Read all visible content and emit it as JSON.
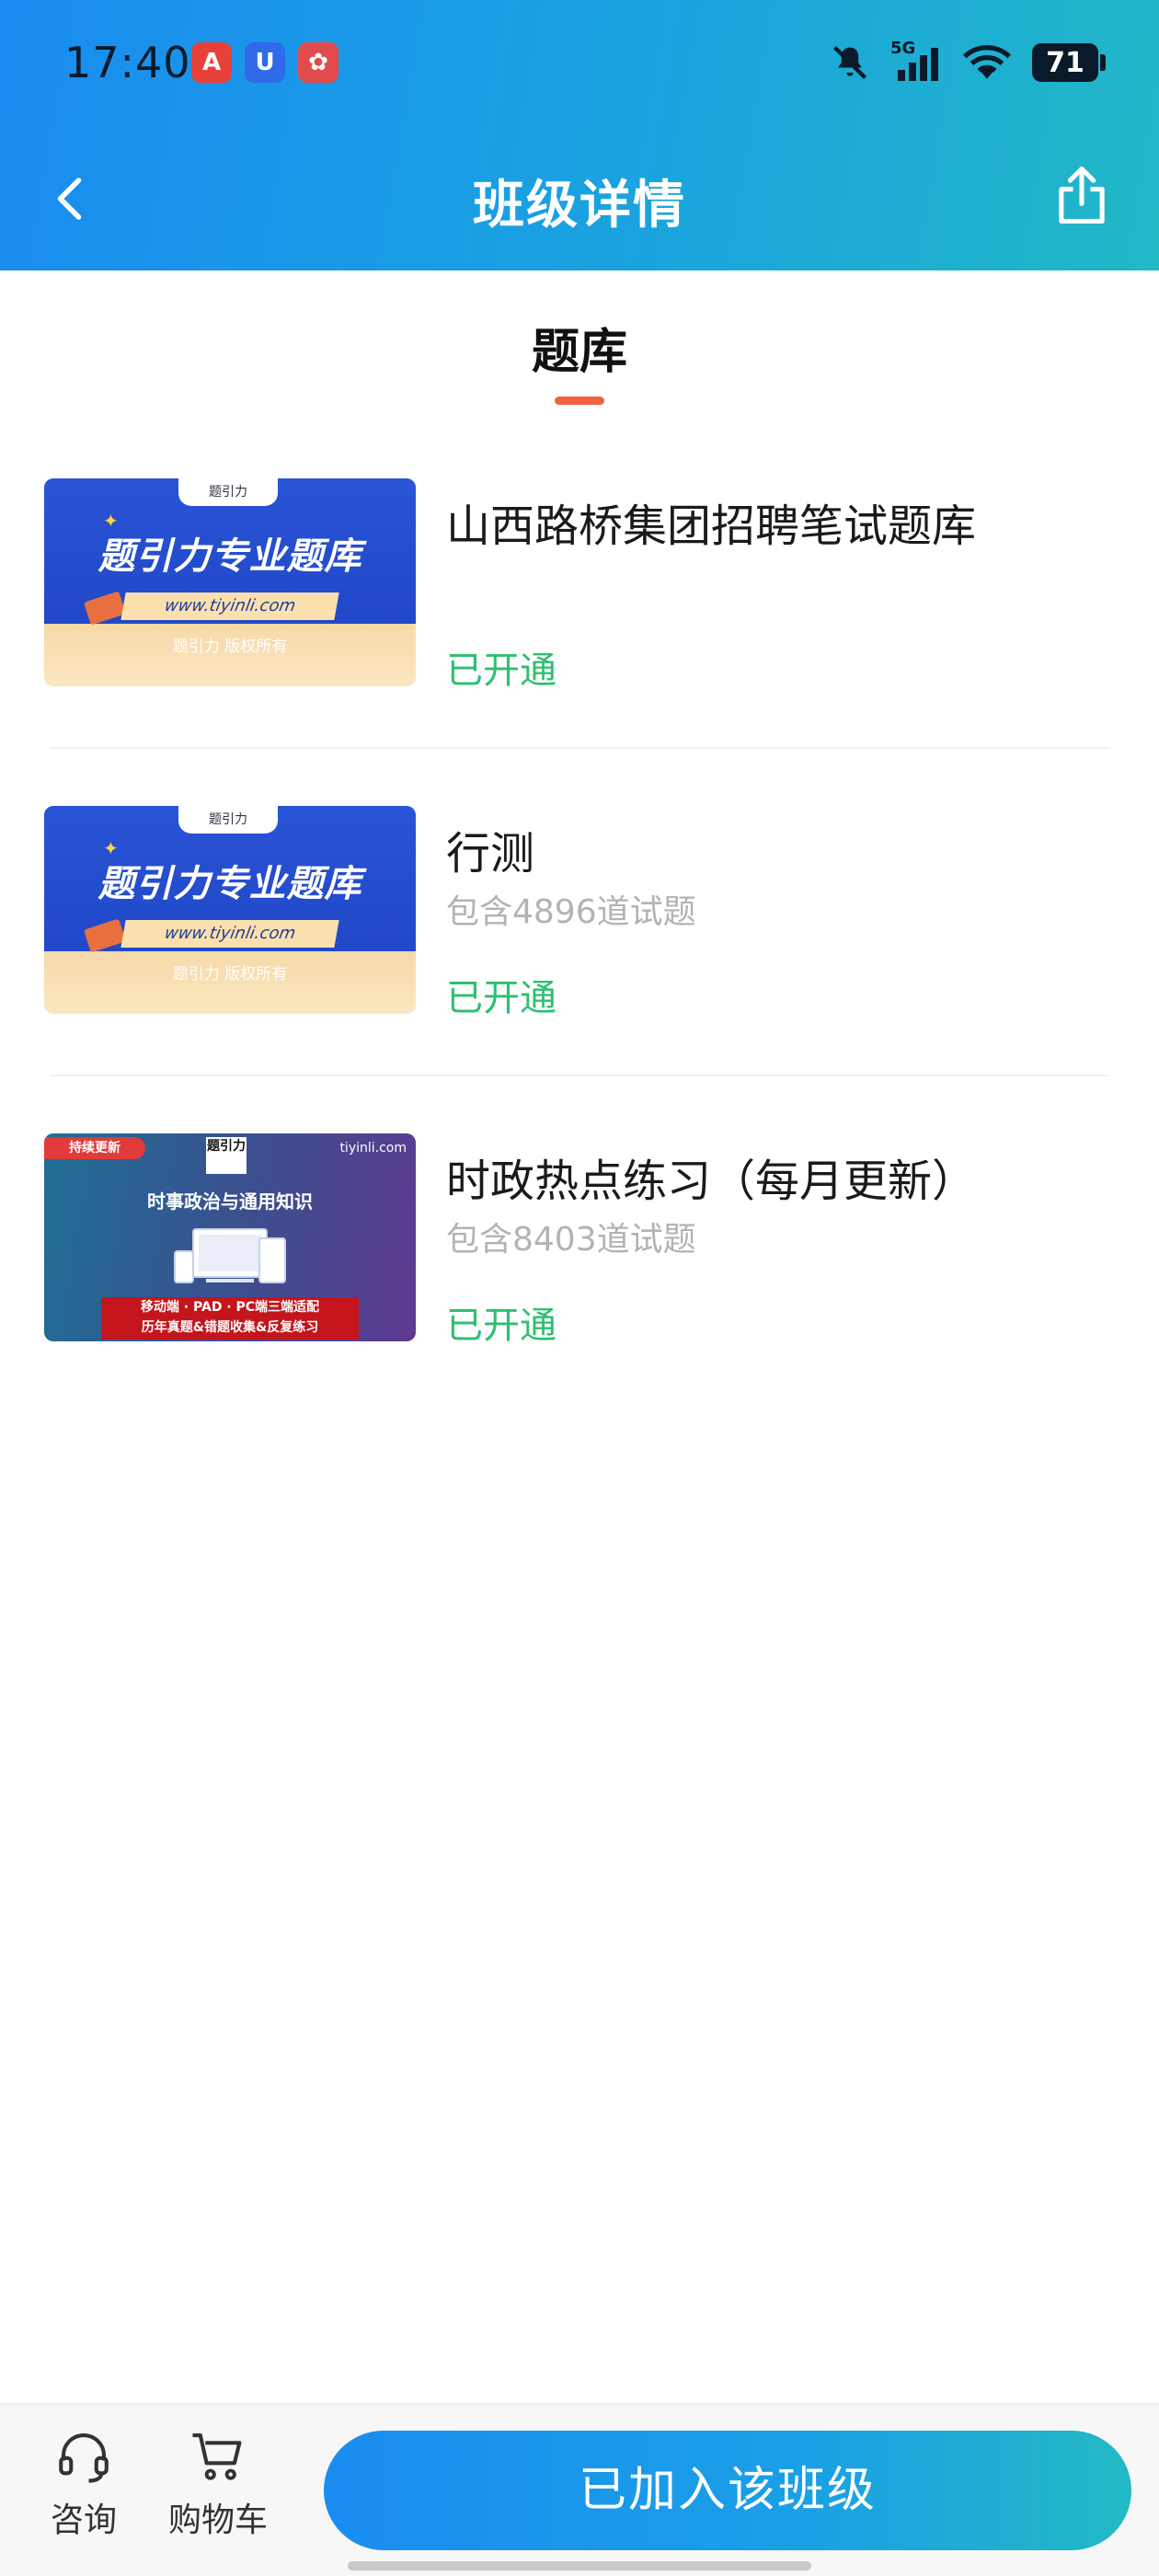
{
  "status_bar": {
    "time": "17:40",
    "apps": [
      {
        "icon": "app-red-a-icon",
        "glyph": "A"
      },
      {
        "icon": "app-blue-shield-icon",
        "glyph": "U"
      },
      {
        "icon": "app-red-pattern-icon",
        "glyph": "✿"
      }
    ],
    "network": "5G",
    "battery": "71"
  },
  "nav": {
    "title": "班级详情",
    "back_icon": "chevron-left-icon",
    "share_icon": "share-icon"
  },
  "section": {
    "title": "题库"
  },
  "items": [
    {
      "title": "山西路桥集团招聘笔试题库",
      "subtitle": "",
      "status": "已开通",
      "thumb": {
        "style": "blue",
        "tab_text": "题引力",
        "headline": "题引力专业题库",
        "url": "www.tiyinli.com",
        "copyright": "题引力 版权所有"
      }
    },
    {
      "title": "行测",
      "subtitle": "包含4896道试题",
      "status": "已开通",
      "thumb": {
        "style": "blue",
        "tab_text": "题引力",
        "headline": "题引力专业题库",
        "url": "www.tiyinli.com",
        "copyright": "题引力 版权所有"
      }
    },
    {
      "title": "时政热点练习（每月更新）",
      "subtitle": "包含8403道试题",
      "status": "已开通",
      "thumb": {
        "style": "purple",
        "badge": "持续更新",
        "logo": "题引力",
        "site": "tiyinli.com",
        "headline": "时事政治与通用知识",
        "bar_line1": "移动端 · PAD · PC端三端适配",
        "bar_line2": "历年真题&错题收集&反复练习"
      }
    }
  ],
  "bottom_bar": {
    "consult_label": "咨询",
    "consult_icon": "headset-icon",
    "cart_label": "购物车",
    "cart_icon": "cart-icon",
    "join_label": "已加入该班级"
  },
  "colors": {
    "header_start": "#1a8cf0",
    "header_end": "#21b8c6",
    "accent_orange": "#f0623f",
    "status_green": "#2fbf71"
  }
}
